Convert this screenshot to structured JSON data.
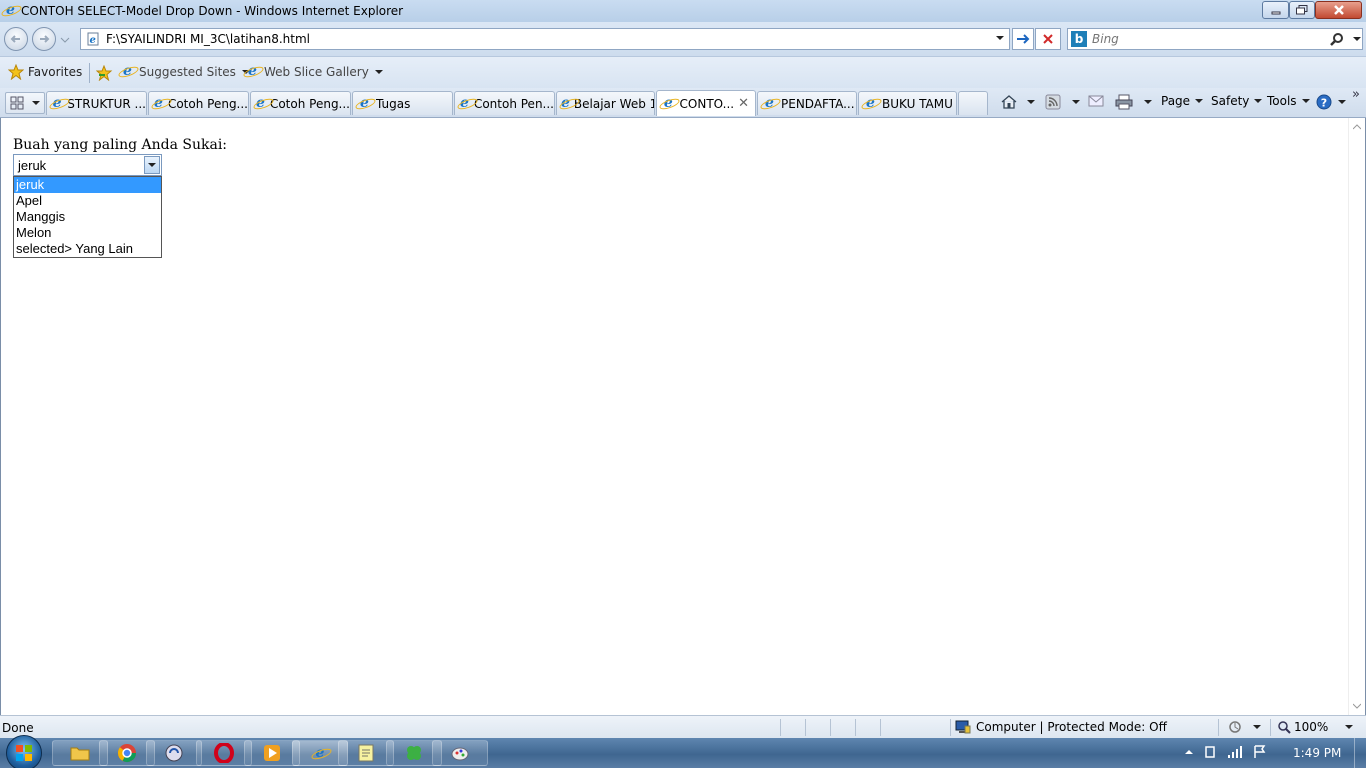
{
  "window": {
    "title": "CONTOH SELECT-Model Drop Down - Windows Internet Explorer"
  },
  "address_bar": {
    "url": "F:\\SYAILINDRI MI_3C\\latihan8.html"
  },
  "search": {
    "placeholder": "Bing"
  },
  "favorites_bar": {
    "favorites_label": "Favorites",
    "suggested_sites_label": "Suggested Sites",
    "web_slice_label": "Web Slice Gallery"
  },
  "tabs": [
    {
      "label": "STRUKTUR ..."
    },
    {
      "label": "Cotoh Peng..."
    },
    {
      "label": "Cotoh Peng..."
    },
    {
      "label": "Tugas"
    },
    {
      "label": "Contoh Pen..."
    },
    {
      "label": "Belajar Web 1"
    },
    {
      "label": "CONTO..."
    },
    {
      "label": "PENDAFTA..."
    },
    {
      "label": "BUKU TAMU"
    }
  ],
  "command_bar": {
    "page_label": "Page",
    "safety_label": "Safety",
    "tools_label": "Tools"
  },
  "page": {
    "label": "Buah yang paling Anda Sukai:",
    "select_value": "jeruk",
    "options": [
      "jeruk",
      "Apel",
      "Manggis",
      "Melon",
      "selected> Yang Lain"
    ],
    "selected_index": 0
  },
  "status_bar": {
    "status": "Done",
    "zone": "Computer | Protected Mode: Off",
    "zoom": "100%"
  },
  "taskbar": {
    "time": "1:49 PM"
  },
  "colors": {
    "selection": "#3399ff",
    "titlebar": "#c9dcf1",
    "close_button": "#c24a32"
  }
}
